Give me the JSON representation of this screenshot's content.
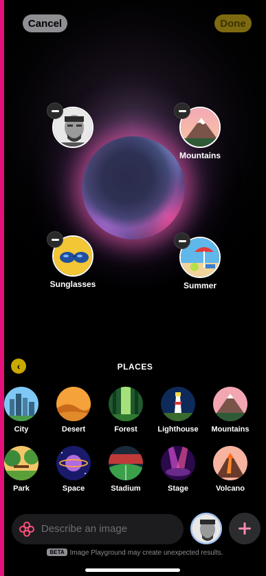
{
  "header": {
    "cancel_label": "Cancel",
    "done_label": "Done"
  },
  "concepts": [
    {
      "label": "",
      "kind": "person"
    },
    {
      "label": "Mountains",
      "kind": "mountains"
    },
    {
      "label": "Sunglasses",
      "kind": "sunglasses"
    },
    {
      "label": "Summer",
      "kind": "summer"
    }
  ],
  "places": {
    "title": "PLACES",
    "items": [
      {
        "label": "City"
      },
      {
        "label": "Desert"
      },
      {
        "label": "Forest"
      },
      {
        "label": "Lighthouse"
      },
      {
        "label": "Mountains"
      },
      {
        "label": "Park"
      },
      {
        "label": "Space"
      },
      {
        "label": "Stadium"
      },
      {
        "label": "Stage"
      },
      {
        "label": "Volcano"
      }
    ]
  },
  "composer": {
    "placeholder": "Describe an image",
    "beta_badge": "BETA",
    "disclaimer": "Image Playground may create unexpected results."
  },
  "colors": {
    "accent_yellow": "#c9a800",
    "screen_bg": "#000000",
    "frame": "#e5117a"
  }
}
